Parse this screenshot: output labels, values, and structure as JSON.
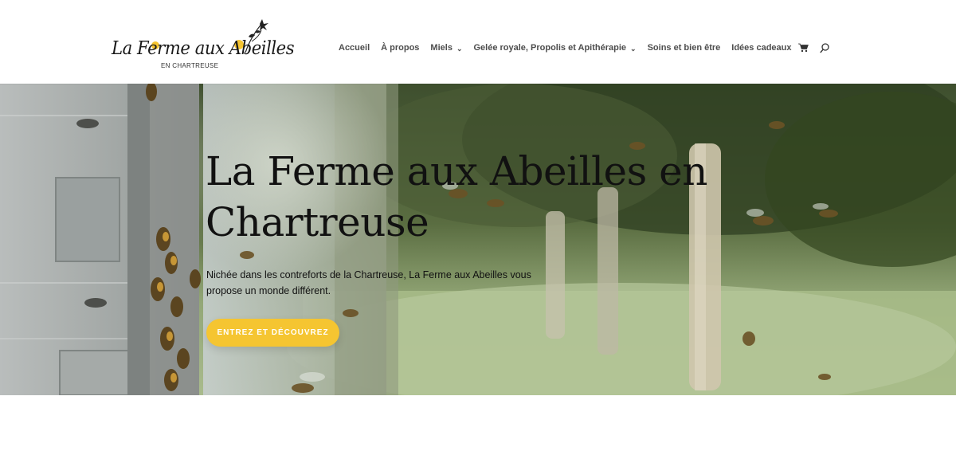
{
  "header": {
    "logo": {
      "title": "La Ferme aux Abeilles",
      "subtitle": "EN CHARTREUSE"
    },
    "nav": {
      "items": [
        {
          "label": "Accueil",
          "has_dropdown": false
        },
        {
          "label": "À propos",
          "has_dropdown": false
        },
        {
          "label": "Miels",
          "has_dropdown": true
        },
        {
          "label": "Gelée royale, Propolis et Apithérapie",
          "has_dropdown": true
        },
        {
          "label": "Soins et bien être",
          "has_dropdown": false
        },
        {
          "label": "Idées cadeaux",
          "has_dropdown": false
        }
      ],
      "dropdown_icon": "chevron-down-icon",
      "cart_icon": "shopping-cart-icon",
      "search_icon": "search-icon"
    }
  },
  "hero": {
    "title": "La Ferme aux Abeilles en Chartreuse",
    "text": "Nichée dans les contreforts de la Chartreuse, La Ferme aux Abeilles vous propose un monde différent.",
    "cta_label": "ENTREZ ET DÉCOUVREZ"
  },
  "colors": {
    "accent": "#f5c531",
    "nav_text": "#4d4d4d",
    "heading": "#111111"
  }
}
